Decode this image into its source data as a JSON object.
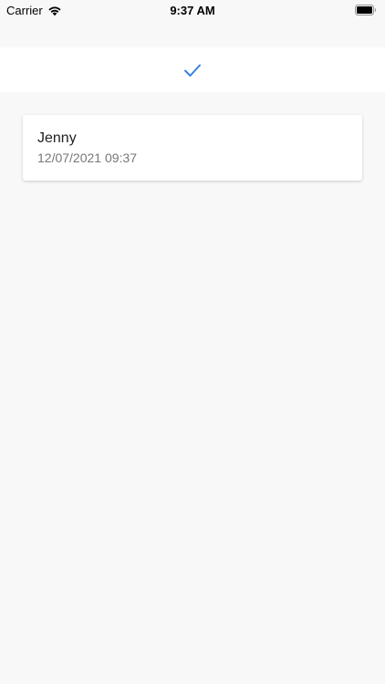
{
  "status_bar": {
    "carrier": "Carrier",
    "time": "9:37 AM",
    "wifi_icon": "wifi-icon",
    "battery_icon": "battery-icon"
  },
  "header": {
    "icon": "check-icon",
    "accent_color": "#3b7fe0"
  },
  "list": {
    "items": [
      {
        "name": "Jenny",
        "date": "12/07/2021 09:37"
      }
    ]
  }
}
